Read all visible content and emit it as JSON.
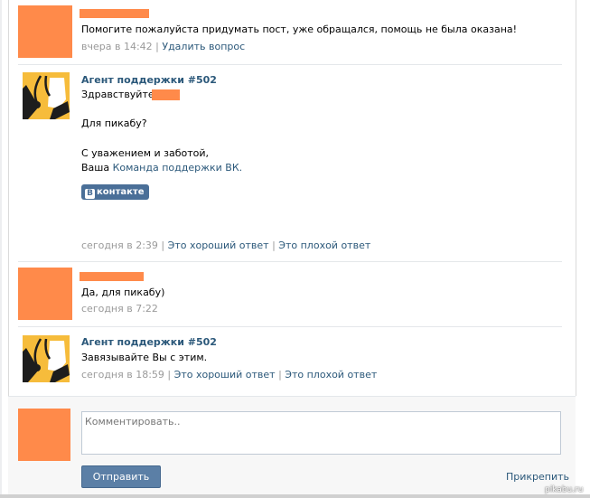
{
  "question": {
    "text": "Помогите пожалуйста придумать пост, уже обращался, помощь не была оказана!",
    "time": "вчера в 14:42",
    "delete_label": "Удалить вопрос"
  },
  "reply1": {
    "author": "Агент поддержки #502",
    "greeting": "Здравствуйте,",
    "line1": "Для пикабу?",
    "sign1": "С уважением и заботой,",
    "sign2_prefix": "Ваша",
    "team_link": "Команда поддержки ВК.",
    "badge": "контакте",
    "badge_letter": "В",
    "time": "сегодня в 2:39",
    "good_label": "Это хороший ответ",
    "bad_label": "Это плохой ответ"
  },
  "user_reply": {
    "text": "Да, для пикабу)",
    "time": "сегодня в 7:22"
  },
  "reply2": {
    "author": "Агент поддержки #502",
    "text": "Завязывайте Вы с этим.",
    "time": "сегодня в 18:59",
    "good_label": "Это хороший ответ",
    "bad_label": "Это плохой ответ"
  },
  "separator": "|",
  "comment": {
    "placeholder": "Комментировать..",
    "send_label": "Отправить",
    "attach_label": "Прикрепить"
  },
  "watermark": "pikabu.ru",
  "colors": {
    "redaction": "#ff8a4a",
    "link": "#2b587a",
    "agent_avatar_bg": "#f6bc3b",
    "button": "#5b7fa6"
  }
}
